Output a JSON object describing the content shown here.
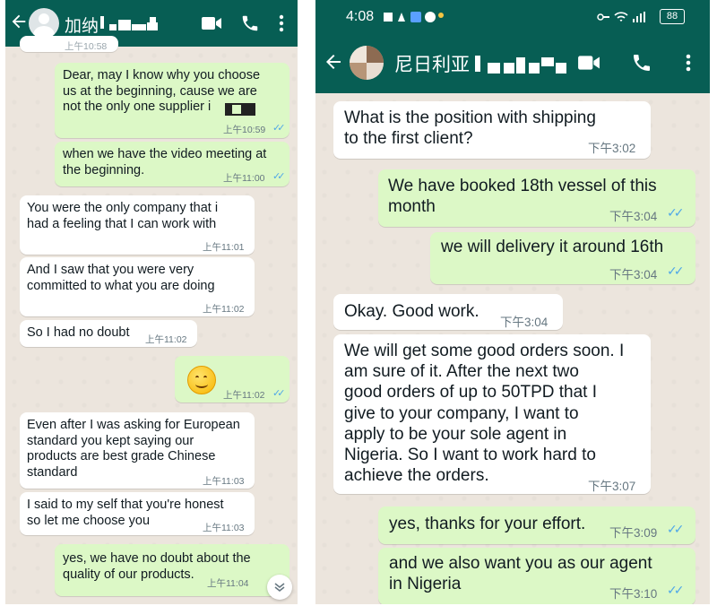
{
  "left_chat": {
    "contact_name": "加纳",
    "partial_top_time": "上午10:58",
    "messages": [
      {
        "dir": "out",
        "text": "Dear, may I know why you choose\nus at the beginning, cause we are\nnot the only one supplier i",
        "time": "上午10:59",
        "read": true
      },
      {
        "dir": "out",
        "text": "when we have the video meeting at\nthe beginning.",
        "time": "上午11:00",
        "read": true
      },
      {
        "dir": "in",
        "text": "You were the only company that i\nhad a feeling that I can work with",
        "time": "上午11:01"
      },
      {
        "dir": "in",
        "text": "And I saw that you were very\ncommitted to what you are doing",
        "time": "上午11:02"
      },
      {
        "dir": "in",
        "text": "So I had no doubt",
        "time": "上午11:02"
      },
      {
        "dir": "out",
        "emoji": "smiling-face",
        "time": "上午11:02",
        "read": true
      },
      {
        "dir": "in",
        "text": "Even after I was asking for European\nstandard you kept saying our\nproducts are best grade Chinese\nstandard",
        "time": "上午11:03"
      },
      {
        "dir": "in",
        "text": "I said to my self that you're honest\nso let me choose you",
        "time": "上午11:03"
      },
      {
        "dir": "out",
        "text": "yes, we have no doubt about the\nquality of our products.",
        "time": "上午11:04",
        "read": false
      }
    ]
  },
  "right_chat": {
    "status_time": "4:08",
    "battery": "88",
    "contact_name": "尼日利亚",
    "messages": [
      {
        "dir": "in",
        "text": "What is the position with shipping\nto the first client?",
        "time": "下午3:02"
      },
      {
        "dir": "out",
        "text": "We have booked 18th vessel of this\nmonth",
        "time": "下午3:04",
        "read": true
      },
      {
        "dir": "out",
        "text": "we will delivery it around 16th",
        "time": "下午3:04",
        "read": true
      },
      {
        "dir": "in",
        "text": "Okay. Good work.",
        "time": "下午3:04"
      },
      {
        "dir": "in",
        "text": "We will get some good orders soon. I\nam sure of it. After the next two\ngood orders of up to 50TPD that I\ngive to your company, I want to\napply to be your sole agent in\nNigeria. So I want to work hard to\nachieve the orders.",
        "time": "下午3:07"
      },
      {
        "dir": "out",
        "text": "yes, thanks for your effort.",
        "time": "下午3:09",
        "read": true
      },
      {
        "dir": "out",
        "text": "and we also want you as our agent\nin Nigeria",
        "time": "下午3:10",
        "read": true
      }
    ]
  },
  "icons": {
    "back": "arrow-left-icon",
    "video": "video-call-icon",
    "call": "phone-call-icon",
    "menu": "more-vertical-icon",
    "scroll_down": "chevron-down-icon"
  },
  "colors": {
    "header": "#075e54",
    "outgoing_bubble": "#dcf8c6",
    "incoming_bubble": "#ffffff",
    "read_ticks": "#4fa7e8",
    "chat_background": "#ece5dd"
  }
}
